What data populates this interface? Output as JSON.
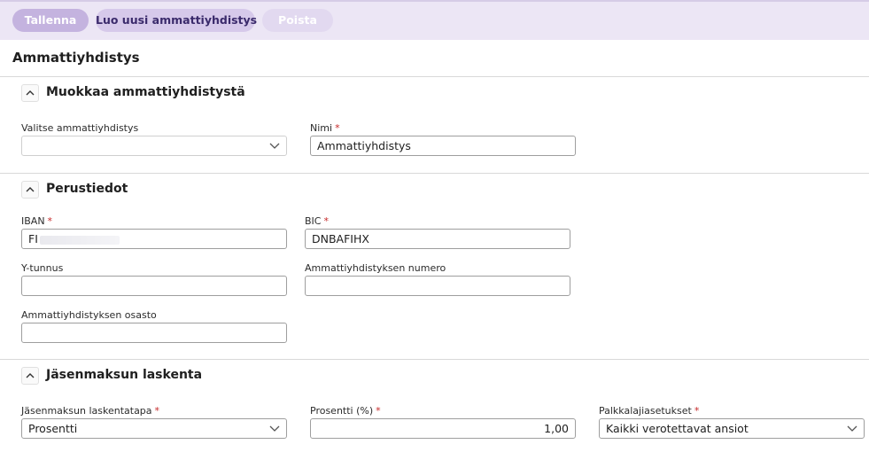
{
  "toolbar": {
    "save_label": "Tallenna",
    "new_label": "Luo uusi ammattiyhdistys",
    "delete_label": "Poista"
  },
  "page": {
    "title": "Ammattiyhdistys"
  },
  "sections": {
    "edit": {
      "title": "Muokkaa ammattiyhdistystä",
      "select_label": "Valitse ammattiyhdistys",
      "select_value": "",
      "name_label": "Nimi",
      "name_value": "Ammattiyhdistys"
    },
    "basic": {
      "title": "Perustiedot",
      "iban_label": "IBAN",
      "iban_value": "FI",
      "bic_label": "BIC",
      "bic_value": "DNBAFIHX",
      "ytunnus_label": "Y-tunnus",
      "ytunnus_value": "",
      "number_label": "Ammattiyhdistyksen numero",
      "number_value": "",
      "branch_label": "Ammattiyhdistyksen osasto",
      "branch_value": ""
    },
    "fee": {
      "title": "Jäsenmaksun laskenta",
      "method_label": "Jäsenmaksun laskentatapa",
      "method_value": "Prosentti",
      "percent_label": "Prosentti (%)",
      "percent_value": "1,00",
      "salary_label": "Palkkalajiasetukset",
      "salary_value": "Kaikki verotettavat ansiot"
    }
  },
  "icons": {
    "collapse": "chevron-up-icon",
    "dropdown": "chevron-down-icon"
  },
  "colors": {
    "toolbar_bg": "#ece6f5",
    "primary_button": "#c4b3df",
    "secondary_button": "#d6c9ea",
    "required": "#c62828"
  }
}
